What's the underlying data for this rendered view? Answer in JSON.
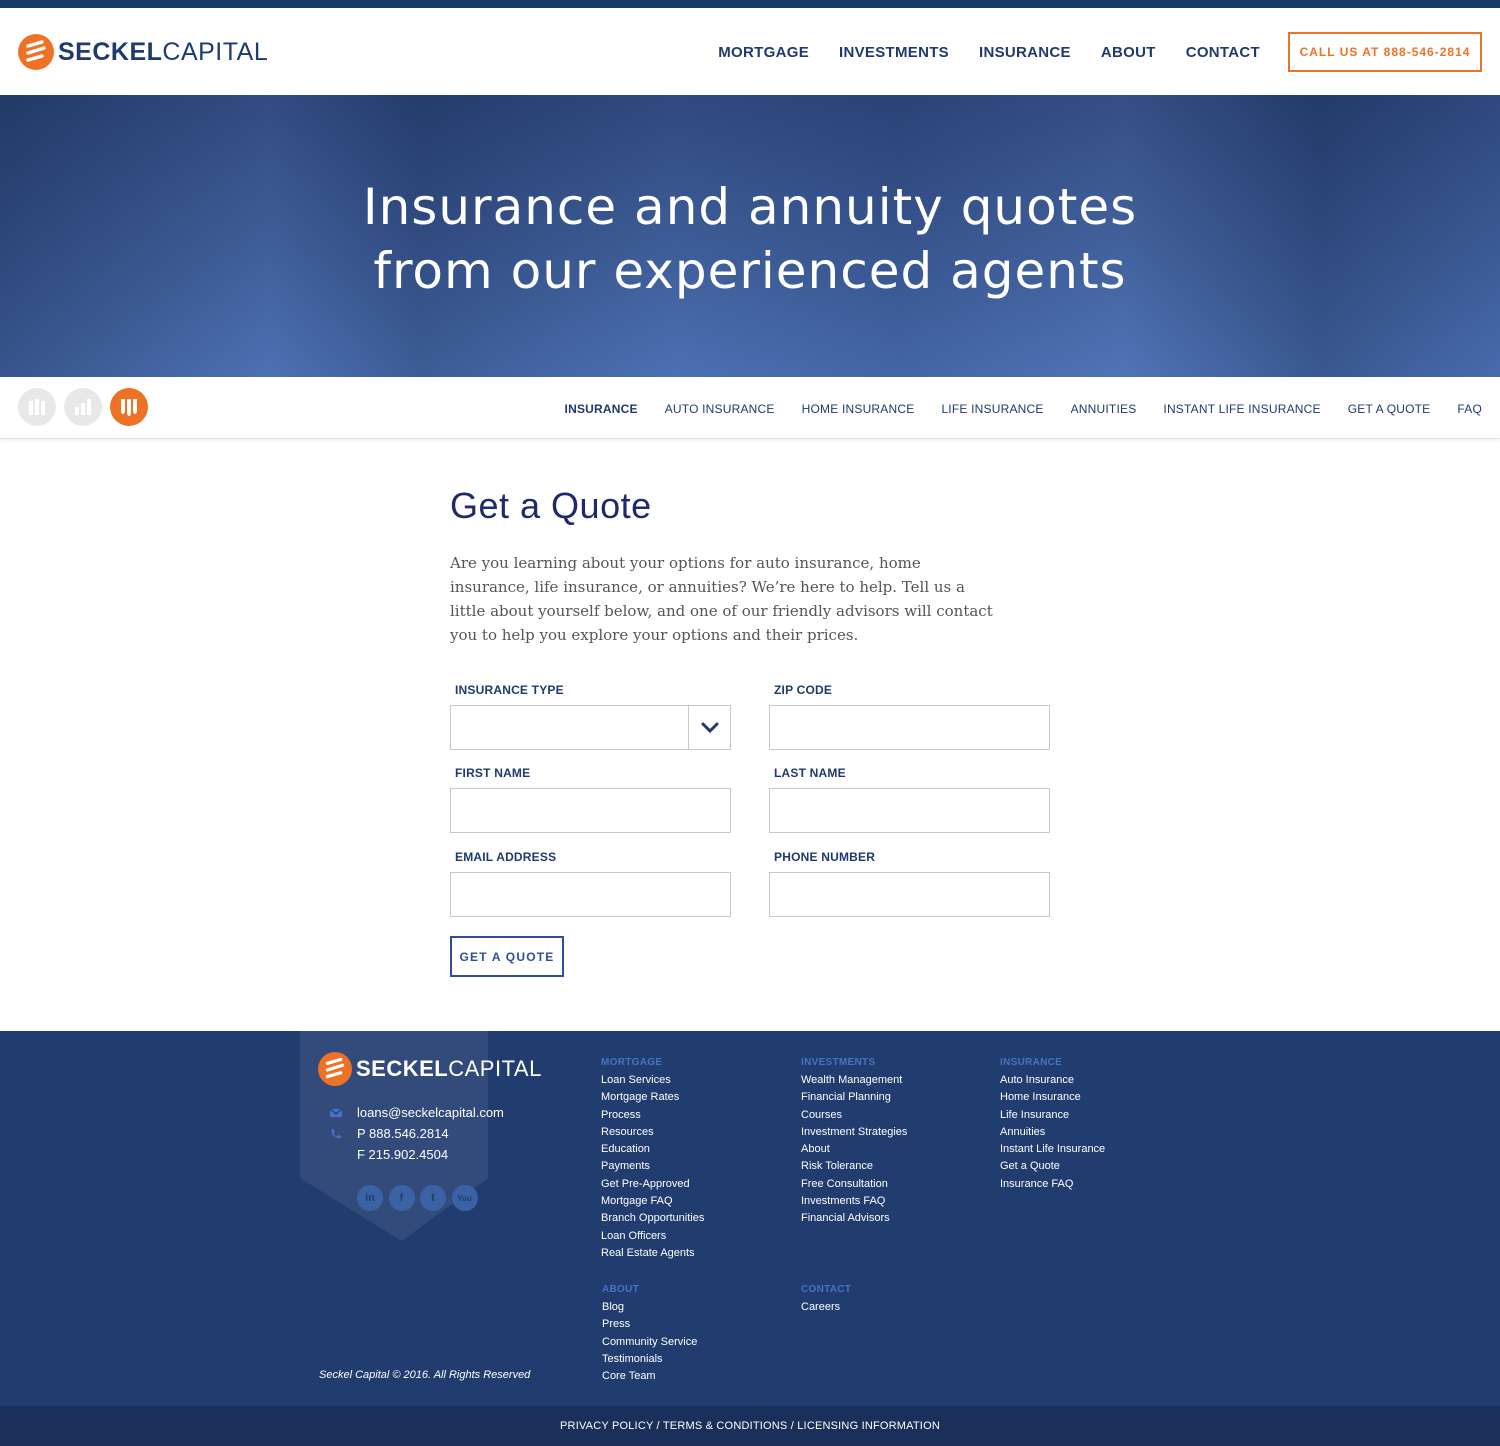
{
  "brand": {
    "name_bold": "SECKEL",
    "name_light": "CAPITAL",
    "accent": "#ee7226",
    "navy": "#1e3a6e"
  },
  "nav": {
    "items": [
      "MORTGAGE",
      "INVESTMENTS",
      "INSURANCE",
      "ABOUT",
      "CONTACT"
    ],
    "call_label": "CALL US AT 888-546-2814"
  },
  "hero": {
    "line1": "Insurance and annuity quotes",
    "line2": "from our experienced agents"
  },
  "subnav": {
    "section_icons": [
      "mortgage-icon",
      "investments-icon",
      "insurance-icon"
    ],
    "items": [
      "INSURANCE",
      "AUTO INSURANCE",
      "HOME INSURANCE",
      "LIFE INSURANCE",
      "ANNUITIES",
      "INSTANT LIFE INSURANCE",
      "GET A QUOTE",
      "FAQ"
    ]
  },
  "page": {
    "title": "Get a Quote",
    "intro": "Are you learning about your options for auto insurance, home insurance, life insurance, or annuities? We’re here to help. Tell us a little about yourself below, and one of our friendly advisors will contact you to help you explore your options and their prices."
  },
  "form": {
    "insurance_type": {
      "label": "INSURANCE TYPE",
      "value": ""
    },
    "zip": {
      "label": "ZIP CODE",
      "value": ""
    },
    "first_name": {
      "label": "FIRST NAME",
      "value": ""
    },
    "last_name": {
      "label": "LAST NAME",
      "value": ""
    },
    "email": {
      "label": "EMAIL ADDRESS",
      "value": ""
    },
    "phone": {
      "label": "PHONE NUMBER",
      "value": ""
    },
    "submit_label": "GET A QUOTE"
  },
  "footer": {
    "email": "loans@seckelcapital.com",
    "phone": "P 888.546.2814",
    "fax": "F 215.902.4504",
    "socials": [
      "linkedin-icon",
      "facebook-icon",
      "twitter-icon",
      "youtube-icon"
    ],
    "social_glyphs": [
      "in",
      "f",
      "t",
      "You"
    ],
    "copyright": "Seckel Capital © 2016. All Rights Reserved",
    "mortgage": {
      "heading": "MORTGAGE",
      "links": [
        "Loan Services",
        "Mortgage Rates",
        "Process",
        "Resources",
        "Education",
        "Payments",
        "Get Pre-Approved",
        "Mortgage FAQ",
        "Branch Opportunities",
        "Loan Officers",
        "Real Estate Agents"
      ]
    },
    "investments": {
      "heading": "INVESTMENTS",
      "links": [
        "Wealth Management",
        "Financial Planning",
        "Courses",
        "Investment Strategies",
        "About",
        "Risk Tolerance",
        "Free Consultation",
        "Investments FAQ",
        "Financial Advisors"
      ]
    },
    "insurance": {
      "heading": "INSURANCE",
      "links": [
        "Auto Insurance",
        "Home Insurance",
        "Life Insurance",
        "Annuities",
        "Instant Life Insurance",
        "Get a Quote",
        "Insurance FAQ"
      ]
    },
    "about": {
      "heading": "ABOUT",
      "links": [
        "Blog",
        "Press",
        "Community Service",
        "Testimonials",
        "Core Team"
      ]
    },
    "contact": {
      "heading": "CONTACT",
      "links": [
        "Careers"
      ]
    },
    "legal": "PRIVACY POLICY / TERMS & CONDITIONS / LICENSING INFORMATION"
  }
}
